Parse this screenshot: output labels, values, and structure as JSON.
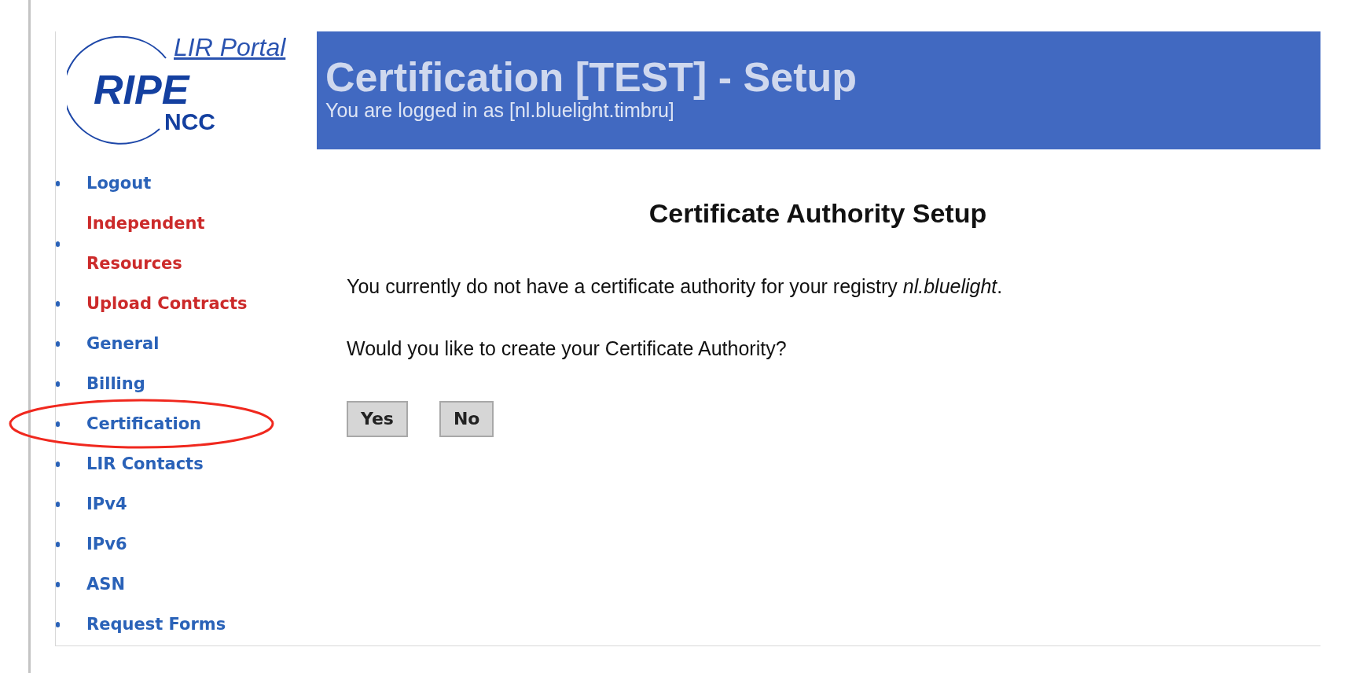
{
  "logo": {
    "portal": "LIR Portal",
    "name": "RIPE",
    "sub": "NCC"
  },
  "header": {
    "title": "Certification [TEST] - Setup",
    "subtitle": "You are logged in as [nl.bluelight.timbru]"
  },
  "sidebar": {
    "items": [
      {
        "label": "Logout",
        "color": "#2a62b8",
        "circled": false
      },
      {
        "label": "Independent Resources",
        "color": "#cc2a2a",
        "circled": false
      },
      {
        "label": "Upload Contracts",
        "color": "#cc2a2a",
        "circled": false
      },
      {
        "label": "General",
        "color": "#2a62b8",
        "circled": false
      },
      {
        "label": "Billing",
        "color": "#2a62b8",
        "circled": false
      },
      {
        "label": "Certification",
        "color": "#2a62b8",
        "circled": true
      },
      {
        "label": "LIR Contacts",
        "color": "#2a62b8",
        "circled": false
      },
      {
        "label": "IPv4",
        "color": "#2a62b8",
        "circled": false
      },
      {
        "label": "IPv6",
        "color": "#2a62b8",
        "circled": false
      },
      {
        "label": "ASN",
        "color": "#2a62b8",
        "circled": false
      },
      {
        "label": "Request Forms",
        "color": "#2a62b8",
        "circled": false
      }
    ]
  },
  "content": {
    "heading": "Certificate Authority Setup",
    "paragraphs": [
      "You currently do not have a certificate authority for your registry *nl.bluelight*.",
      "Would you like to create your Certificate Authority?"
    ],
    "buttons": [
      "Yes",
      "No"
    ]
  }
}
